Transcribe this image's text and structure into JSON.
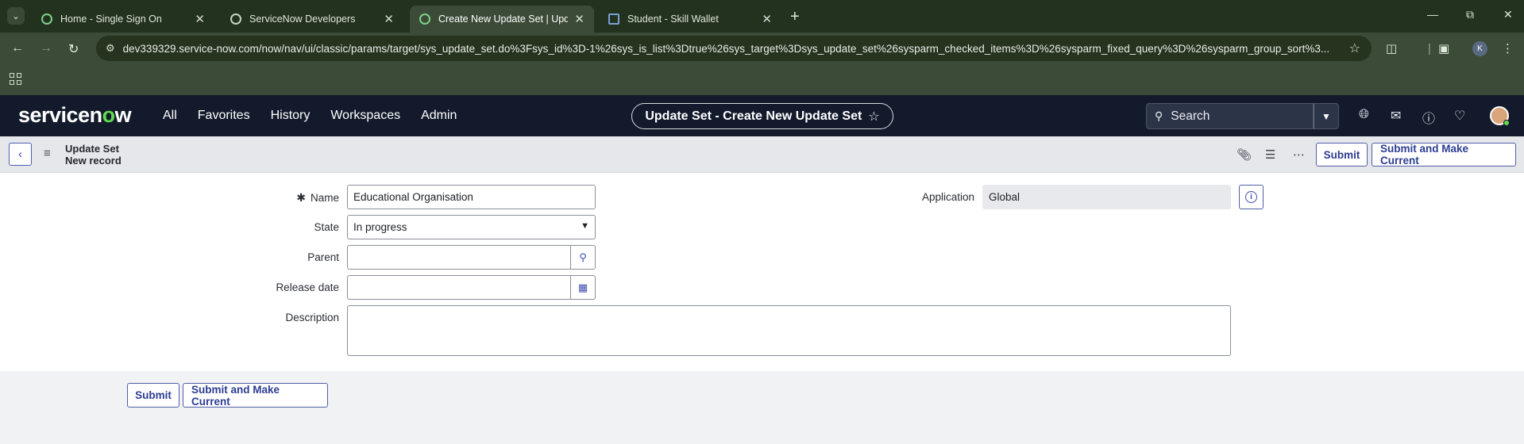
{
  "browser": {
    "tabs": [
      {
        "title": "Home - Single Sign On",
        "active": false
      },
      {
        "title": "ServiceNow Developers",
        "active": false
      },
      {
        "title": "Create New Update Set | Updat",
        "active": true
      },
      {
        "title": "Student - Skill Wallet",
        "active": false
      }
    ],
    "url": "dev339329.service-now.com/now/nav/ui/classic/params/target/sys_update_set.do%3Fsys_id%3D-1%26sys_is_list%3Dtrue%26sys_target%3Dsys_update_set%26sysparm_checked_items%3D%26sysparm_fixed_query%3D%26sysparm_group_sort%3...",
    "profile_initial": "K"
  },
  "header": {
    "nav": [
      "All",
      "Favorites",
      "History",
      "Workspaces",
      "Admin"
    ],
    "context_title": "Update Set - Create New Update Set",
    "search_placeholder": "Search"
  },
  "record": {
    "table": "Update Set",
    "subtitle": "New record",
    "submit_label": "Submit",
    "submit_current_label": "Submit and Make Current"
  },
  "form": {
    "name_label": "Name",
    "name_value": "Educational Organisation",
    "state_label": "State",
    "state_value": "In progress",
    "parent_label": "Parent",
    "parent_value": "",
    "release_label": "Release date",
    "release_value": "",
    "description_label": "Description",
    "description_value": "",
    "application_label": "Application",
    "application_value": "Global"
  },
  "colors": {
    "accent": "#2c3d91",
    "header_bg": "#121a2c",
    "brand_green": "#62d84e"
  }
}
